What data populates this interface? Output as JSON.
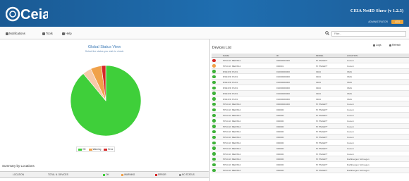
{
  "header": {
    "logo_text": "Ceia",
    "app_title": "CEIA NetID Show (v 1.2.3)",
    "user": "ADMINISTRATOR",
    "logout_label": "LOG",
    "bg_color": "#1d63a3"
  },
  "toolbar": {
    "items": [
      {
        "label": "Notifications",
        "icon": "bell-icon"
      },
      {
        "label": "Tools",
        "icon": "tools-icon"
      },
      {
        "label": "Help",
        "icon": "help-icon"
      }
    ],
    "search_placeholder": "Filter..."
  },
  "left": {
    "chart_title": "Global Status View",
    "chart_subtitle": "Select the status you wish to check",
    "legend": [
      {
        "label": "OK",
        "color": "#3fcf3a"
      },
      {
        "label": "Warning",
        "color": "#f0a14a"
      },
      {
        "label": "Error",
        "color": "#d62828"
      }
    ],
    "summary_title": "Summary by Locations",
    "summary_headers": [
      {
        "label": "LOCATION",
        "color": ""
      },
      {
        "label": "TOTAL N. DEVICES",
        "color": ""
      },
      {
        "label": "OK",
        "color": "#3fcf3a"
      },
      {
        "label": "WARNING",
        "color": "#f0a14a"
      },
      {
        "label": "ERROR",
        "color": "#d62828"
      },
      {
        "label": "NO STATUS",
        "color": "#999999"
      }
    ]
  },
  "chart_data": {
    "type": "pie",
    "title": "Global Status View",
    "slices": [
      {
        "label": "OK",
        "value": 89,
        "color": "#3fcf3a"
      },
      {
        "label": "Warning",
        "value": 5,
        "color": "#f0a14a"
      },
      {
        "label": "Error",
        "value": 2,
        "color": "#d62828"
      },
      {
        "label": "No status",
        "value": 4,
        "color": "#f7c9a8"
      }
    ]
  },
  "right": {
    "title": "Devices List",
    "buttons": [
      {
        "label": "Logs",
        "icon": "log-icon"
      },
      {
        "label": "Refresh",
        "icon": "refresh-icon"
      }
    ],
    "columns": [
      "NAME",
      "ID",
      "MODEL",
      "LOCATION"
    ],
    "rows": [
      {
        "status": "error",
        "name": "HPVA1V MERN12",
        "id": "00000001000",
        "model": "HI PNAEPT",
        "location": "Cucuni"
      },
      {
        "status": "warning",
        "name": "HPVA1V MERN12",
        "id": "000001",
        "model": "HI PNAEPT",
        "location": "Cucuni"
      },
      {
        "status": "ok",
        "name": "R9N4VD PUD1",
        "id": "01000000000",
        "model": "0944",
        "location": "OMA"
      },
      {
        "status": "ok",
        "name": "R9N4VD PUD1",
        "id": "01000000000",
        "model": "0944",
        "location": "OMA"
      },
      {
        "status": "ok",
        "name": "R9N4VD PUD1",
        "id": "01000000000",
        "model": "0944",
        "location": "OMA"
      },
      {
        "status": "ok",
        "name": "R9N4VD PUD1",
        "id": "01000000000",
        "model": "0944",
        "location": "OMA"
      },
      {
        "status": "ok",
        "name": "R9N4VD PUD1",
        "id": "01000000000",
        "model": "0944",
        "location": "OMA"
      },
      {
        "status": "ok",
        "name": "R9N4VD PUD1",
        "id": "01000000000",
        "model": "0944",
        "location": "OMA"
      },
      {
        "status": "ok",
        "name": "HPVA1V MERN12",
        "id": "00000001000",
        "model": "HI PNAEPT",
        "location": "Cucuni"
      },
      {
        "status": "ok",
        "name": "HPVA1V MERN12",
        "id": "000000",
        "model": "HI PNAEPT",
        "location": "Cucuni"
      },
      {
        "status": "ok",
        "name": "HPVA1V MERN12",
        "id": "000000",
        "model": "HI PNAEPT",
        "location": "Cucuni"
      },
      {
        "status": "ok",
        "name": "HPVA1V MERN12",
        "id": "000000",
        "model": "HI PNAEPT",
        "location": "Cucuni"
      },
      {
        "status": "ok",
        "name": "HPVA1V MERN12",
        "id": "000000",
        "model": "HI PNAEPT",
        "location": "Cucuni"
      },
      {
        "status": "ok",
        "name": "HPVA1V MERN12",
        "id": "000000",
        "model": "HI PNAEPT",
        "location": "Cucuni"
      },
      {
        "status": "ok",
        "name": "HPVA1V MERN12",
        "id": "000000",
        "model": "HI PNAEPT",
        "location": "Cucuni"
      },
      {
        "status": "ok",
        "name": "HPVA1V MERN12",
        "id": "000000",
        "model": "HI PNAEPT",
        "location": "Cucuni"
      },
      {
        "status": "ok",
        "name": "HPVA1V MERN12",
        "id": "000000",
        "model": "HI PNAEPT",
        "location": "Cucuni"
      },
      {
        "status": "ok",
        "name": "HPVA1V MERN12",
        "id": "000000",
        "model": "HI PNAEPT",
        "location": "Cucuni"
      },
      {
        "status": "ok",
        "name": "HPVA1V MERN12",
        "id": "000000",
        "model": "HI PNAEPT",
        "location": "Rathbiergen Schnegen"
      },
      {
        "status": "ok",
        "name": "HPVA1V MERN12",
        "id": "000000",
        "model": "HI PNAEPT",
        "location": "Rathbiergen Schnegen"
      },
      {
        "status": "ok",
        "name": "HPVA1V MERN12",
        "id": "000000",
        "model": "HI PNAEPT",
        "location": "Rathbiergen Schnegen"
      }
    ]
  },
  "status_colors": {
    "ok": "#3fb23a",
    "warning": "#f0a14a",
    "error": "#d62828"
  }
}
